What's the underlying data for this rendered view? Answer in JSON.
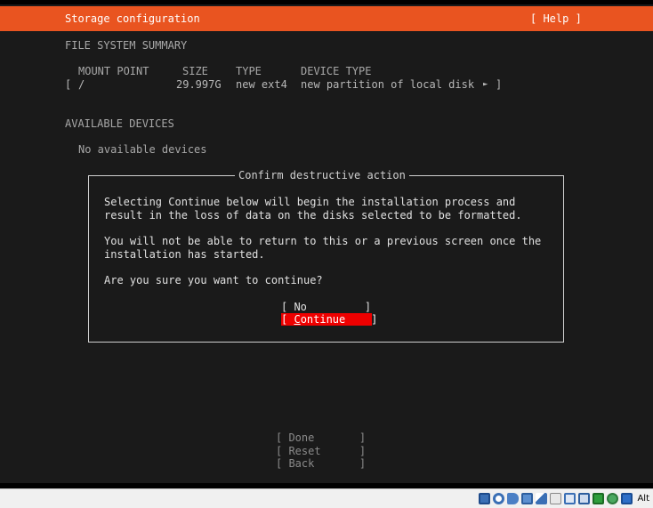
{
  "header": {
    "title": "Storage configuration",
    "help": "[ Help ]"
  },
  "fs_summary": {
    "heading": "FILE SYSTEM SUMMARY",
    "columns": [
      "MOUNT POINT",
      "SIZE",
      "TYPE",
      "DEVICE TYPE"
    ],
    "row": {
      "open": "[",
      "mount": "/",
      "size": "29.997G",
      "type": "new ext4",
      "device": "new partition of local disk",
      "arrow": "►",
      "close": "]"
    }
  },
  "available": {
    "heading": "AVAILABLE DEVICES",
    "empty": "No available devices"
  },
  "dialog": {
    "title": "Confirm destructive action",
    "lines": [
      "Selecting Continue below will begin the installation process and",
      "result in the loss of data on the disks selected to be formatted.",
      "You will not be able to return to this or a previous screen once the",
      "installation has started.",
      "Are you sure you want to continue?"
    ],
    "no_button": "[ No         ]",
    "continue_first": "C",
    "continue_rest": "ontinue    ]",
    "continue_open": "[ "
  },
  "bottom_buttons": [
    "[ Done       ]",
    "[ Reset      ]",
    "[ Back       ]"
  ],
  "taskbar": {
    "alt_label": "Alt",
    "icons": [
      "disk-icon",
      "cd-icon",
      "audio-icon",
      "network-icon",
      "usb-icon",
      "shared-folder-icon",
      "display-icon",
      "recording-icon",
      "cpu-icon",
      "mouse-integration-icon",
      "keyboard-icon"
    ]
  }
}
